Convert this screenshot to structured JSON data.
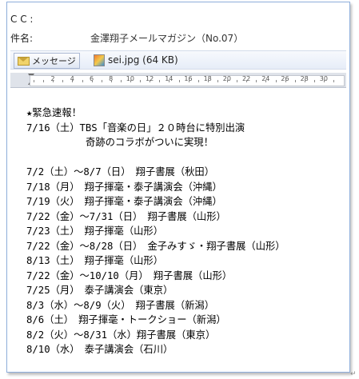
{
  "header": {
    "cc_label": "C C :",
    "subject_label": "件名:",
    "subject_value": "金澤翔子メールマガジン（No.07）"
  },
  "attachments": {
    "message_button_label": "メッセージ",
    "file_label": "sei.jpg (64 KB)",
    "icons": [
      "envelope-icon",
      "image-file-icon"
    ]
  },
  "ruler": {
    "numbers": [
      "2",
      "4",
      "6",
      "8",
      "10",
      "12",
      "14",
      "16",
      "18",
      "20",
      "22",
      "24",
      "26",
      "28",
      "30"
    ]
  },
  "body": {
    "lines": [
      "★緊急速報！",
      "7/16（土）TBS「音楽の日」２０時台に特別出演",
      "          奇跡のコラボがついに実現！",
      "",
      "7/2（土）～8/7（日）　翔子書展（秋田）",
      "7/18（月）　翔子揮毫・泰子講演会（沖縄）",
      "7/19（火）　翔子揮毫・泰子講演会（沖縄）",
      "7/22（金）～7/31（日）　翔子書展（山形）",
      "7/23（土）　翔子揮毫（山形）",
      "7/22（金）～8/28（日）　金子みすゞ・翔子書展（山形）",
      "8/13（土）　翔子揮毫（山形）",
      "7/22（金）～10/10（月）　翔子書展（山形）",
      "7/25（月）　泰子講演会（東京）",
      "8/3（水）～8/9（火）　翔子書展（新潟）",
      "8/6（土）　翔子揮毫・トークショー（新潟）",
      "8/2（火）～8/31（水）翔子書展（東京）",
      "8/10（水）　泰子講演会（石川）"
    ]
  },
  "paragraph_mark": "↵"
}
